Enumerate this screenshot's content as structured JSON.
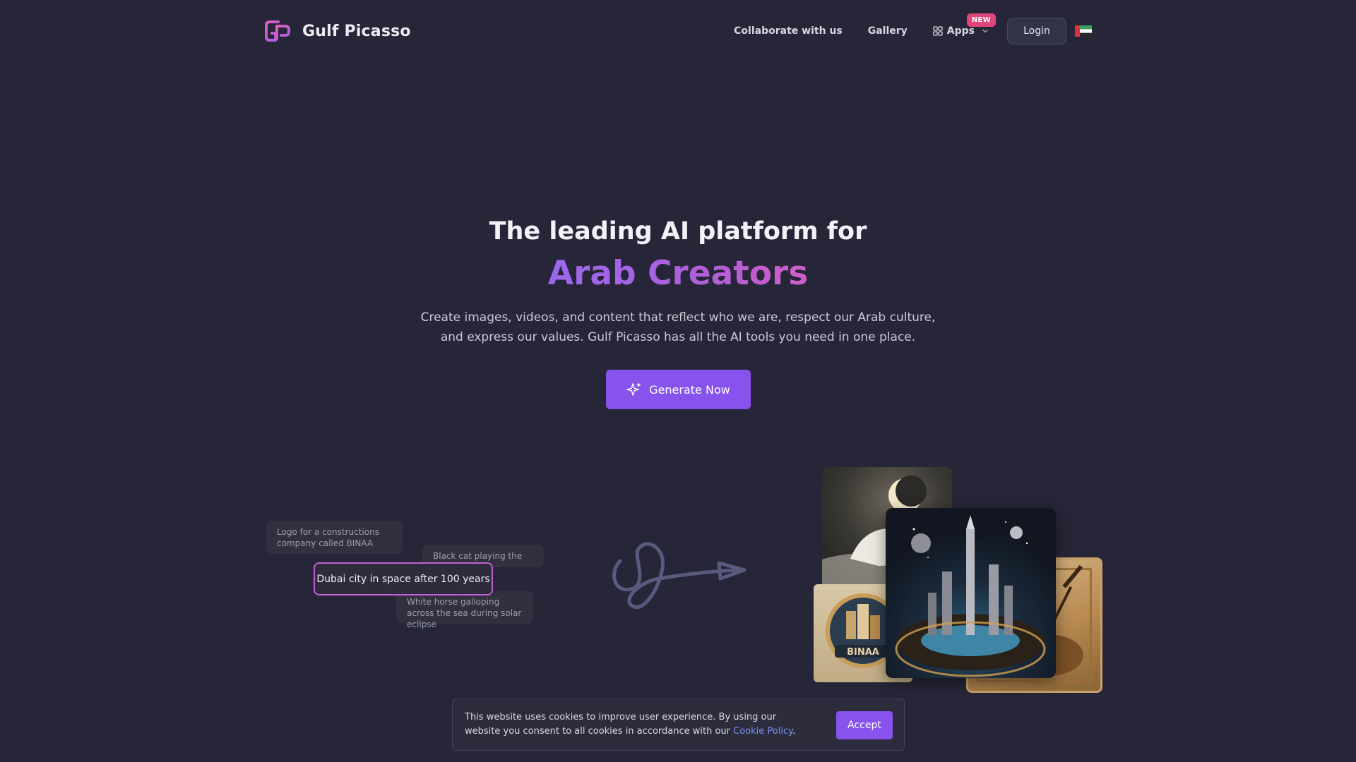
{
  "header": {
    "brand": "Gulf Picasso",
    "nav": {
      "collaborate": "Collaborate with us",
      "gallery": "Gallery",
      "apps": "Apps",
      "new_badge": "NEW",
      "login": "Login"
    }
  },
  "hero": {
    "title": "The leading AI platform for",
    "accent": "Arab Creators",
    "description": "Create images, videos, and content that reflect who we are, respect our Arab culture, and express our values. Gulf Picasso has all the AI tools you need in one place.",
    "cta": "Generate Now"
  },
  "prompts": {
    "binaa": "Logo for a constructions company called BINAA",
    "cat": "Black cat playing the Oud",
    "dubai": "Dubai city in space after 100 years",
    "horse": "White horse galloping across the sea during solar eclipse"
  },
  "collage": {
    "binaa_logo_text": "BINAA"
  },
  "cookie": {
    "text": "This website uses cookies to improve user experience. By using our website you consent to all cookies in accordance with our",
    "link": "Cookie Policy",
    "period": ".",
    "accept": "Accept"
  },
  "colors": {
    "background": "#262638",
    "primary": "#8853ec",
    "accent_gradient_start": "#9a68ee",
    "accent_gradient_end": "#d05ec8",
    "badge": "#e0467a",
    "link": "#7c8ff2"
  },
  "icons": [
    "gulf-picasso-logo-icon",
    "apps-grid-icon",
    "chevron-down-icon",
    "uae-flag-icon",
    "sparkle-icon",
    "squiggle-arrow-icon"
  ]
}
